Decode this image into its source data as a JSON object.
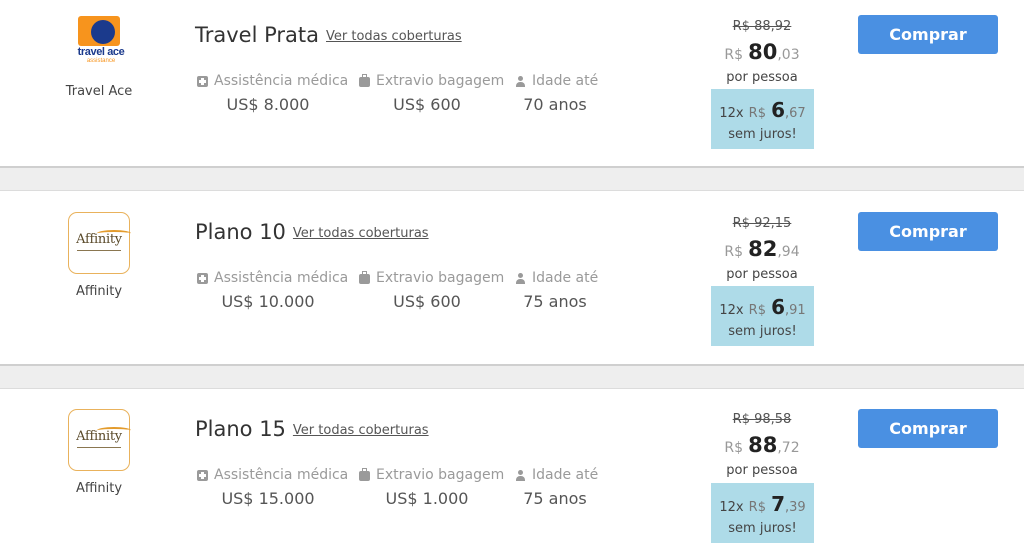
{
  "plans": [
    {
      "insurer": "Travel Ace",
      "logo": {
        "line1": "travel ace",
        "line2": "assistance"
      },
      "title": "Travel Prata",
      "coverage_link": "Ver todas coberturas",
      "medical_label": "Assistência médica",
      "medical_value": "US$ 8.000",
      "baggage_label": "Extravio bagagem",
      "baggage_value": "US$ 600",
      "age_label": "Idade até",
      "age_value": "70 anos",
      "old_price": "R$ 88,92",
      "currency": "R$",
      "price_int": "80",
      "price_dec": ",03",
      "per_person": "por pessoa",
      "installments": "12x",
      "inst_currency": "R$",
      "inst_int": "6",
      "inst_dec": ",67",
      "inst_note": "sem juros!",
      "buy_label": "Comprar"
    },
    {
      "insurer": "Affinity",
      "logo": {
        "text": "Affinity"
      },
      "title": "Plano 10",
      "coverage_link": "Ver todas coberturas",
      "medical_label": "Assistência médica",
      "medical_value": "US$ 10.000",
      "baggage_label": "Extravio bagagem",
      "baggage_value": "US$ 600",
      "age_label": "Idade até",
      "age_value": "75 anos",
      "old_price": "R$ 92,15",
      "currency": "R$",
      "price_int": "82",
      "price_dec": ",94",
      "per_person": "por pessoa",
      "installments": "12x",
      "inst_currency": "R$",
      "inst_int": "6",
      "inst_dec": ",91",
      "inst_note": "sem juros!",
      "buy_label": "Comprar"
    },
    {
      "insurer": "Affinity",
      "logo": {
        "text": "Affinity"
      },
      "title": "Plano 15",
      "coverage_link": "Ver todas coberturas",
      "medical_label": "Assistência médica",
      "medical_value": "US$ 15.000",
      "baggage_label": "Extravio bagagem",
      "baggage_value": "US$ 1.000",
      "age_label": "Idade até",
      "age_value": "75 anos",
      "old_price": "R$ 98,58",
      "currency": "R$",
      "price_int": "88",
      "price_dec": ",72",
      "per_person": "por pessoa",
      "installments": "12x",
      "inst_currency": "R$",
      "inst_int": "7",
      "inst_dec": ",39",
      "inst_note": "sem juros!",
      "buy_label": "Comprar"
    }
  ],
  "colors": {
    "button": "#4a90e2",
    "installment_bg": "#aedbe8",
    "logo_border": "#e9b25c"
  }
}
